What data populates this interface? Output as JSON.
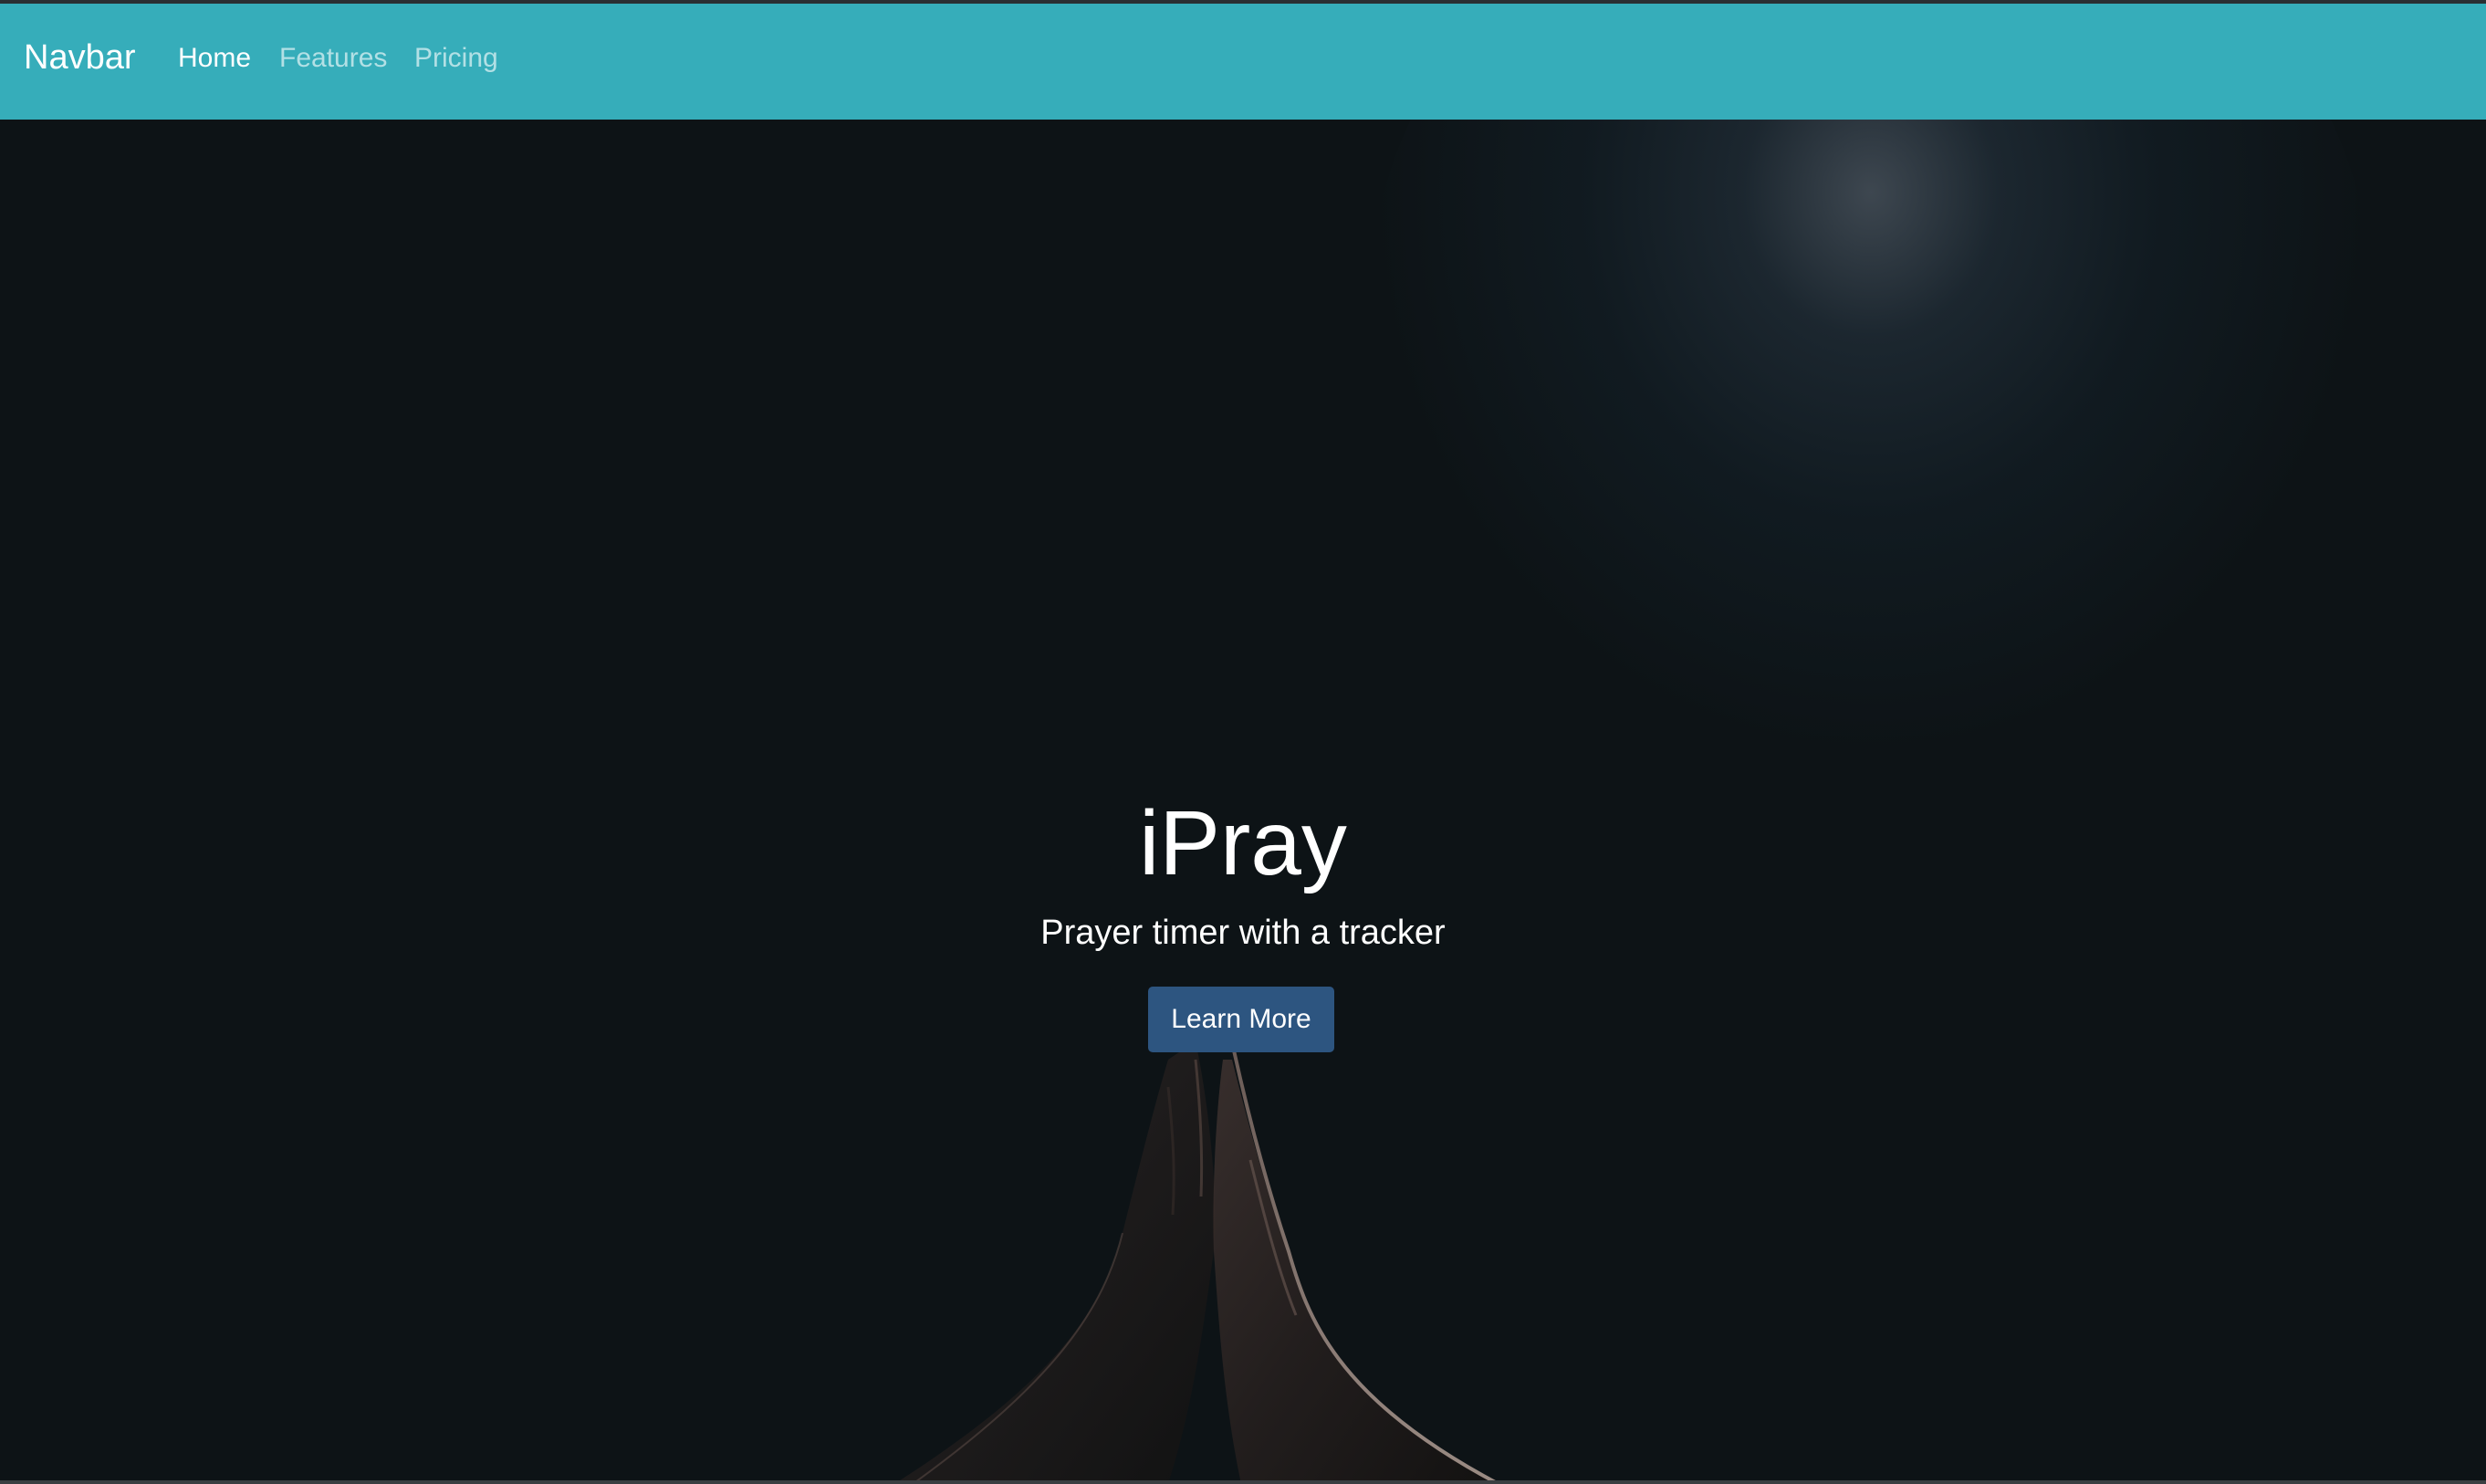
{
  "navbar": {
    "brand": "Navbar",
    "links": [
      {
        "label": "Home",
        "active": true
      },
      {
        "label": "Features",
        "active": false
      },
      {
        "label": "Pricing",
        "active": false
      }
    ],
    "background_color": "#36adba"
  },
  "hero": {
    "title": "iPray",
    "subtitle": "Prayer timer with a tracker",
    "button_label": "Learn More",
    "button_color": "#2d5580",
    "background_color": "#0d1316",
    "background_image": "praying-hands-photo"
  }
}
